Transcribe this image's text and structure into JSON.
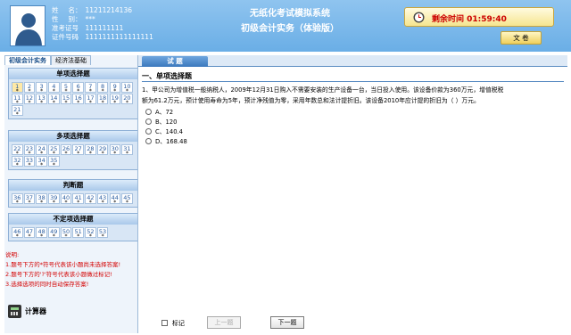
{
  "header": {
    "title": "无纸化考试模拟系统",
    "subtitle": "初级会计实务（体验版）",
    "info": [
      {
        "label": "姓名",
        "value": "11211214136"
      },
      {
        "label": "性别",
        "value": "***"
      },
      {
        "label": "准考证号",
        "value": "111111111"
      },
      {
        "label": "证件号码",
        "value": "1111111111111111"
      }
    ],
    "timer_label": "剩余时间 01:59:40",
    "doc_button": "文 卷"
  },
  "subject_tabs": [
    "初级会计实务",
    "经济法基础"
  ],
  "sections": [
    {
      "title": "单项选择题",
      "numbers": [
        "1",
        "2",
        "3",
        "4",
        "5",
        "6",
        "7",
        "8",
        "9",
        "10",
        "11",
        "12",
        "13",
        "14",
        "15",
        "16",
        "17",
        "18",
        "19",
        "20",
        "21"
      ]
    },
    {
      "title": "多项选择题",
      "numbers": [
        "22",
        "23",
        "24",
        "25",
        "26",
        "27",
        "28",
        "29",
        "30",
        "31",
        "32",
        "33",
        "34",
        "35"
      ]
    },
    {
      "title": "判断题",
      "numbers": [
        "36",
        "37",
        "38",
        "39",
        "40",
        "41",
        "42",
        "43",
        "44",
        "45"
      ]
    },
    {
      "title": "不定项选择题",
      "numbers": [
        "46",
        "47",
        "48",
        "49",
        "50",
        "51",
        "52",
        "53"
      ]
    }
  ],
  "notes": [
    "说明:",
    "1.题号下方的*符号代表该小题尚未选择答案!",
    "2.题号下方的'?'符号代表该小题做过标记!",
    "3.选择选项的同时自动保存答案!"
  ],
  "calculator_label": "计算器",
  "main": {
    "tab_label": "试 题",
    "question_type": "一、单项选择题",
    "question_text": "1、甲公司为增值税一般纳税人，2009年12月31日购入不需要安装的生产设备一台，当日投入使用。该设备价款为360万元，增值税税额为61.2万元，预计使用寿命为5年，预计净残值为零，采用年数总和法计提折旧。该设备2010年应计提的折旧为（ ）万元。",
    "options": [
      "A、72",
      "B、120",
      "C、140.4",
      "D、168.48"
    ],
    "mark_label": "标记",
    "prev_label": "上一题",
    "next_label": "下一题"
  }
}
